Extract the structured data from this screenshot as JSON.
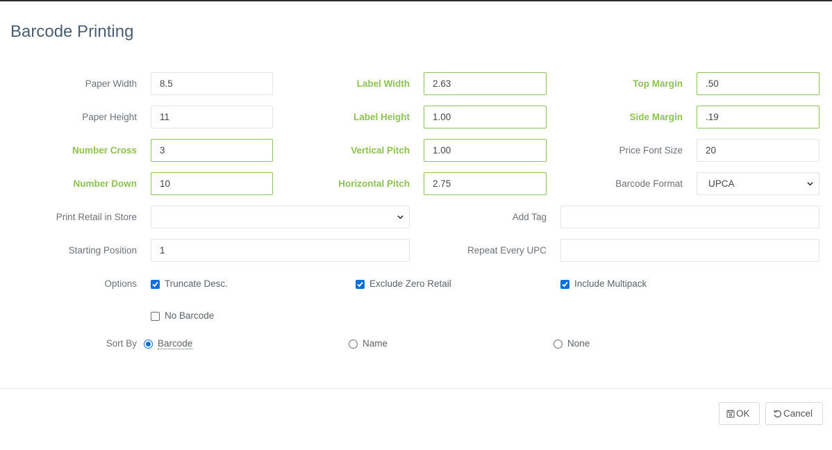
{
  "dialog": {
    "title": "Barcode Printing"
  },
  "fields": {
    "paper_width": {
      "label": "Paper Width",
      "value": "8.5"
    },
    "paper_height": {
      "label": "Paper Height",
      "value": "11"
    },
    "number_cross": {
      "label": "Number Cross",
      "value": "3"
    },
    "number_down": {
      "label": "Number Down",
      "value": "10"
    },
    "label_width": {
      "label": "Label Width",
      "value": "2.63"
    },
    "label_height": {
      "label": "Label Height",
      "value": "1.00"
    },
    "vertical_pitch": {
      "label": "Vertical Pitch",
      "value": "1.00"
    },
    "horizontal_pitch": {
      "label": "Horizontal Pitch",
      "value": "2.75"
    },
    "top_margin": {
      "label": "Top Margin",
      "value": ".50"
    },
    "side_margin": {
      "label": "Side Margin",
      "value": ".19"
    },
    "price_font_size": {
      "label": "Price Font Size",
      "value": "20"
    },
    "barcode_format": {
      "label": "Barcode Format",
      "value": "UPCA"
    },
    "print_retail_in_store": {
      "label": "Print Retail in Store",
      "value": ""
    },
    "starting_position": {
      "label": "Starting Position",
      "value": "1"
    },
    "add_tag": {
      "label": "Add Tag",
      "value": ""
    },
    "repeat_every_upc": {
      "label": "Repeat Every UPC",
      "value": ""
    }
  },
  "options": {
    "label": "Options",
    "truncate_desc": {
      "label": "Truncate Desc.",
      "checked": true
    },
    "exclude_zero_retail": {
      "label": "Exclude Zero Retail",
      "checked": true
    },
    "include_multipack": {
      "label": "Include Multipack",
      "checked": true
    },
    "no_barcode": {
      "label": "No Barcode",
      "checked": false
    }
  },
  "sort_by": {
    "label": "Sort By",
    "selected": "Barcode",
    "choices": [
      "Barcode",
      "Name",
      "None"
    ]
  },
  "footer": {
    "ok_label": "OK",
    "cancel_label": "Cancel"
  },
  "colors": {
    "required_label": "#8dc152",
    "accent": "#0b6fd8",
    "title": "#4b5d71"
  },
  "icons": {
    "ok": "save-icon",
    "cancel": "undo-icon",
    "select": "chevron-down-icon"
  }
}
